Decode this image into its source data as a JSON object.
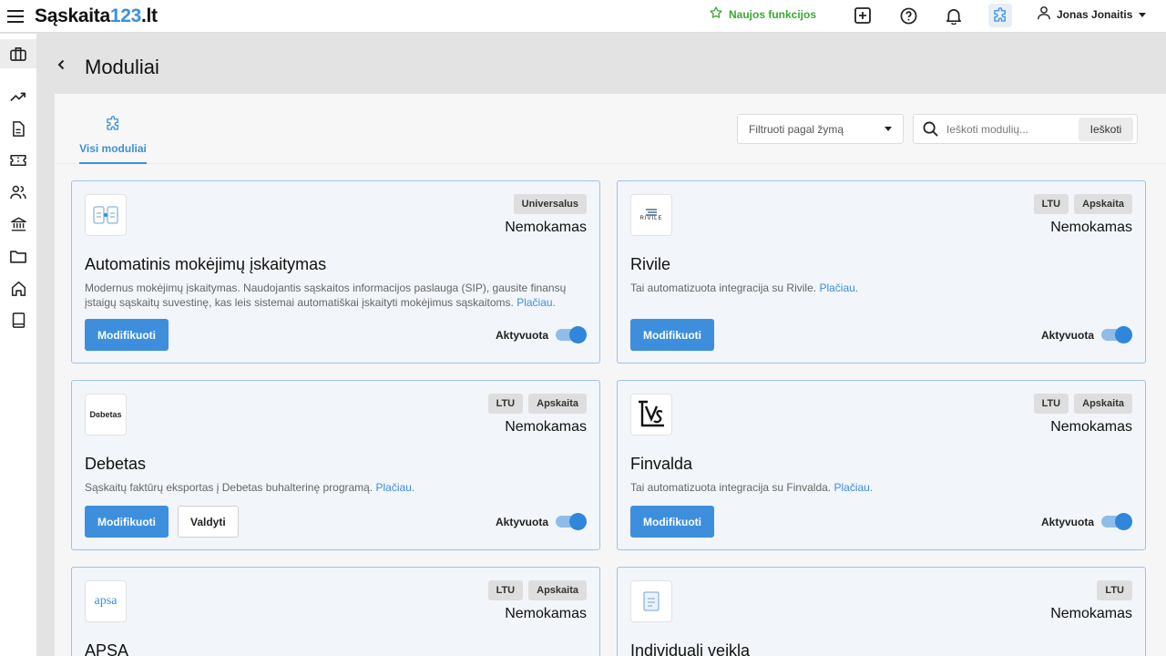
{
  "app": {
    "brand_part1": "Sąskaita",
    "brand_part2": "123",
    "brand_part3": ".lt",
    "new_features_label": "Naujos funkcijos",
    "user_name": "Jonas Jonaitis",
    "accent_color": "#3d8fde",
    "success_color": "#3aa832"
  },
  "topbar_icons": [
    "add-box-icon",
    "help-icon",
    "bell-icon",
    "puzzle-icon"
  ],
  "sidebar": {
    "icons": [
      "briefcase-icon",
      "trending-up-icon",
      "document-icon",
      "ticket-icon",
      "users-icon",
      "bank-icon",
      "folder-icon",
      "home-icon",
      "book-icon"
    ]
  },
  "page": {
    "title": "Moduliai"
  },
  "tabs": [
    {
      "label": "Visi moduliai",
      "active": true
    }
  ],
  "filter": {
    "placeholder": "Filtruoti pagal žymą"
  },
  "search": {
    "placeholder": "Ieškoti modulių...",
    "button_label": "Ieškoti"
  },
  "cards": [
    {
      "title": "Automatinis mokėjimų įskaitymas",
      "tags": [
        "Universalus"
      ],
      "price": "Nemokamas",
      "description": "Modernus mokėjimų įskaitymas. Naudojantis sąskaitos informacijos paslauga (SIP), gausite finansų įstaigų sąskaitų suvestinę, kas leis sistemai automatiškai įskaityti mokėjimus sąskaitoms.",
      "more_label": "Plačiau.",
      "primary_label": "Modifikuoti",
      "active_label": "Aktyvuota",
      "active": true,
      "logo": "bank-transfer-logo"
    },
    {
      "title": "Rivile",
      "tags": [
        "LTU",
        "Apskaita"
      ],
      "price": "Nemokamas",
      "description": "Tai automatizuota integracija su Rivile.",
      "more_label": "Plačiau.",
      "primary_label": "Modifikuoti",
      "active_label": "Aktyvuota",
      "active": true,
      "logo_text": "RIVILE"
    },
    {
      "title": "Debetas",
      "tags": [
        "LTU",
        "Apskaita"
      ],
      "price": "Nemokamas",
      "description": "Sąskaitų faktūrų eksportas į Debetas buhalterinę programą.",
      "more_label": "Plačiau.",
      "primary_label": "Modifikuoti",
      "secondary_label": "Valdyti",
      "active_label": "Aktyvuota",
      "active": true,
      "logo_text": "Dɞbetas"
    },
    {
      "title": "Finvalda",
      "tags": [
        "LTU",
        "Apskaita"
      ],
      "price": "Nemokamas",
      "description": "Tai automatizuota integracija su Finvalda.",
      "more_label": "Plačiau.",
      "primary_label": "Modifikuoti",
      "active_label": "Aktyvuota",
      "active": true,
      "logo": "finvalda-logo"
    },
    {
      "title": "APSA",
      "tags": [
        "LTU",
        "Apskaita"
      ],
      "price": "Nemokamas",
      "logo_text": "apsa"
    },
    {
      "title": "Individuali veikla",
      "tags": [
        "LTU"
      ],
      "price": "Nemokamas",
      "logo": "document-logo"
    }
  ]
}
